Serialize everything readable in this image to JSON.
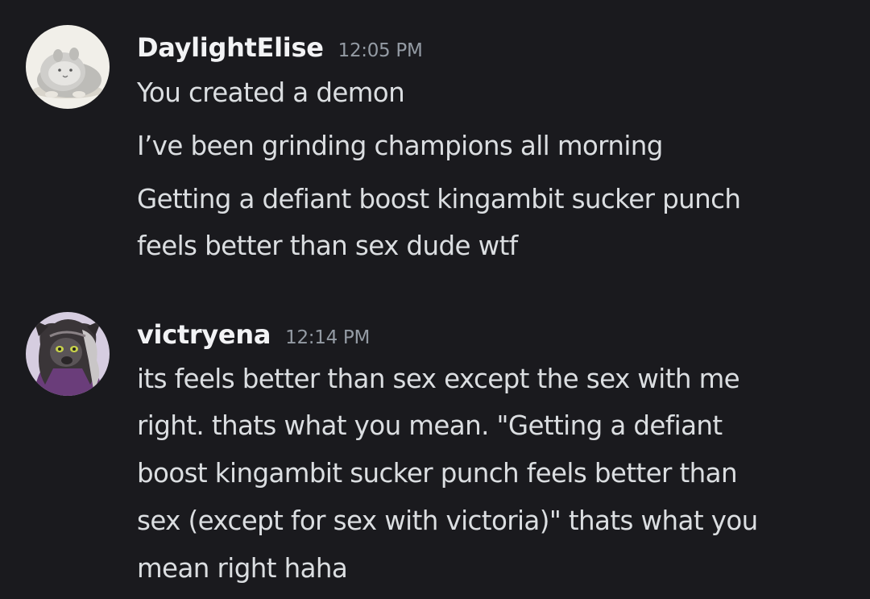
{
  "theme": {
    "background": "#1a1a1e",
    "username_color": "#f2f3f5",
    "text_color": "#dbdee1",
    "timestamp_color": "#949ba4"
  },
  "messages": [
    {
      "username": "DaylightElise",
      "timestamp": "12:05 PM",
      "avatar_icon": "hamster-avatar-icon",
      "lines": [
        "You created a demon",
        "I’ve been grinding champions all morning",
        "Getting a defiant boost kingambit sucker punch",
        "feels better than sex dude wtf"
      ]
    },
    {
      "username": "victryena",
      "timestamp": "12:14 PM",
      "avatar_icon": "hyena-character-avatar-icon",
      "lines": [
        "its feels better than sex except the sex with me",
        "right. thats what you mean. \"Getting a defiant",
        "boost kingambit sucker punch feels better than",
        "sex (except for sex with victoria)\" thats what you",
        "mean right haha"
      ]
    }
  ]
}
